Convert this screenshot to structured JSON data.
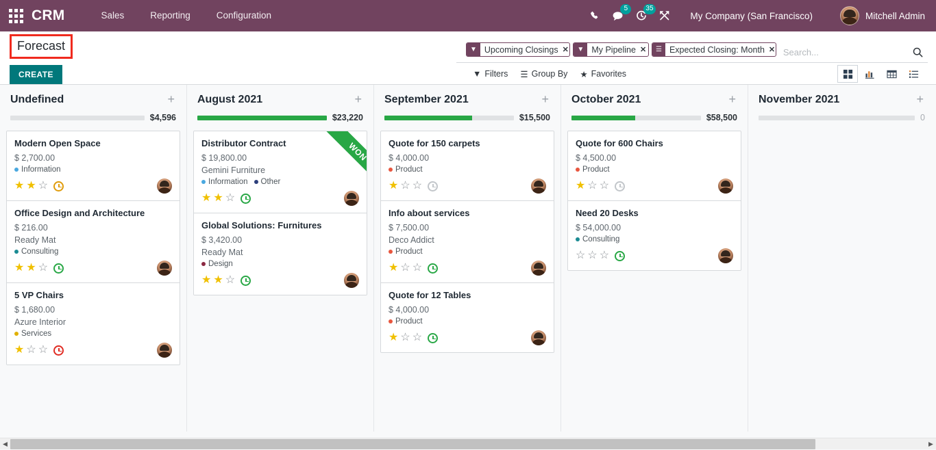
{
  "navbar": {
    "apps_icon": "apps-grid-icon",
    "brand": "CRM",
    "menu": [
      {
        "label": "Sales"
      },
      {
        "label": "Reporting"
      },
      {
        "label": "Configuration"
      }
    ],
    "phone_icon": "phone-icon",
    "messages_icon": "messages-icon",
    "messages_count": "5",
    "activities_icon": "activities-clock-icon",
    "activities_count": "35",
    "debug_icon": "developer-tools-icon",
    "company": "My Company (San Francisco)",
    "user": "Mitchell Admin",
    "avatar": "user-avatar"
  },
  "control_panel": {
    "title": "Forecast",
    "create_label": "CREATE",
    "search": {
      "placeholder": "Search...",
      "facets": [
        {
          "icon": "filter-icon",
          "label": "Upcoming Closings",
          "remove": "×"
        },
        {
          "icon": "filter-icon",
          "label": "My Pipeline",
          "remove": "×"
        },
        {
          "icon": "groupby-icon",
          "label": "Expected Closing: Month",
          "remove": "×"
        }
      ]
    },
    "menus": [
      {
        "icon": "filter-icon",
        "label": "Filters"
      },
      {
        "icon": "groupby-icon",
        "label": "Group By"
      },
      {
        "icon": "star-icon",
        "label": "Favorites"
      }
    ],
    "views": [
      {
        "name": "kanban",
        "active": true
      },
      {
        "name": "graph",
        "active": false
      },
      {
        "name": "pivot",
        "active": false
      },
      {
        "name": "list",
        "active": false
      }
    ]
  },
  "kanban": {
    "columns": [
      {
        "title": "Undefined",
        "total": "$4,596",
        "progress_pct": 0,
        "cards": [
          {
            "title": "Modern Open Space",
            "amount": "$ 2,700.00",
            "partner": "",
            "tags": [
              {
                "label": "Information",
                "color": "#4AA8E0"
              }
            ],
            "stars": 2,
            "clock": "orange"
          },
          {
            "title": "Office Design and Architecture",
            "amount": "$ 216.00",
            "partner": "Ready Mat",
            "tags": [
              {
                "label": "Consulting",
                "color": "#1B8B93"
              }
            ],
            "stars": 2,
            "clock": "green"
          },
          {
            "title": "5 VP Chairs",
            "amount": "$ 1,680.00",
            "partner": "Azure Interior",
            "tags": [
              {
                "label": "Services",
                "color": "#E0B000"
              }
            ],
            "stars": 1,
            "clock": "red"
          }
        ]
      },
      {
        "title": "August 2021",
        "total": "$23,220",
        "progress_pct": 100,
        "cards": [
          {
            "title": "Distributor Contract",
            "amount": "$ 19,800.00",
            "partner": "Gemini Furniture",
            "tags": [
              {
                "label": "Information",
                "color": "#4AA8E0"
              },
              {
                "label": "Other",
                "color": "#2C3E7B"
              }
            ],
            "stars": 2,
            "clock": "green",
            "ribbon": "WON"
          },
          {
            "title": "Global Solutions: Furnitures",
            "amount": "$ 3,420.00",
            "partner": "Ready Mat",
            "tags": [
              {
                "label": "Design",
                "color": "#8B2942"
              }
            ],
            "stars": 2,
            "clock": "green"
          }
        ]
      },
      {
        "title": "September 2021",
        "total": "$15,500",
        "progress_pct": 68,
        "cards": [
          {
            "title": "Quote for 150 carpets",
            "amount": "$ 4,000.00",
            "partner": "",
            "tags": [
              {
                "label": "Product",
                "color": "#E8563F"
              }
            ],
            "stars": 1,
            "clock": "grey"
          },
          {
            "title": "Info about services",
            "amount": "$ 7,500.00",
            "partner": "Deco Addict",
            "tags": [
              {
                "label": "Product",
                "color": "#E8563F"
              }
            ],
            "stars": 1,
            "clock": "green"
          },
          {
            "title": "Quote for 12 Tables",
            "amount": "$ 4,000.00",
            "partner": "",
            "tags": [
              {
                "label": "Product",
                "color": "#E8563F"
              }
            ],
            "stars": 1,
            "clock": "green"
          }
        ]
      },
      {
        "title": "October 2021",
        "total": "$58,500",
        "progress_pct": 49,
        "cards": [
          {
            "title": "Quote for 600 Chairs",
            "amount": "$ 4,500.00",
            "partner": "",
            "tags": [
              {
                "label": "Product",
                "color": "#E8563F"
              }
            ],
            "stars": 1,
            "clock": "grey"
          },
          {
            "title": "Need 20 Desks",
            "amount": "$ 54,000.00",
            "partner": "",
            "tags": [
              {
                "label": "Consulting",
                "color": "#1B8B93"
              }
            ],
            "stars": 0,
            "clock": "green"
          }
        ]
      },
      {
        "title": "November 2021",
        "total": "0",
        "progress_pct": 0,
        "cards": []
      }
    ]
  },
  "colors": {
    "brand_purple": "#71435F",
    "accent_teal": "#00787B",
    "progress_green": "#28A745",
    "highlight_red": "#F02A1E"
  }
}
